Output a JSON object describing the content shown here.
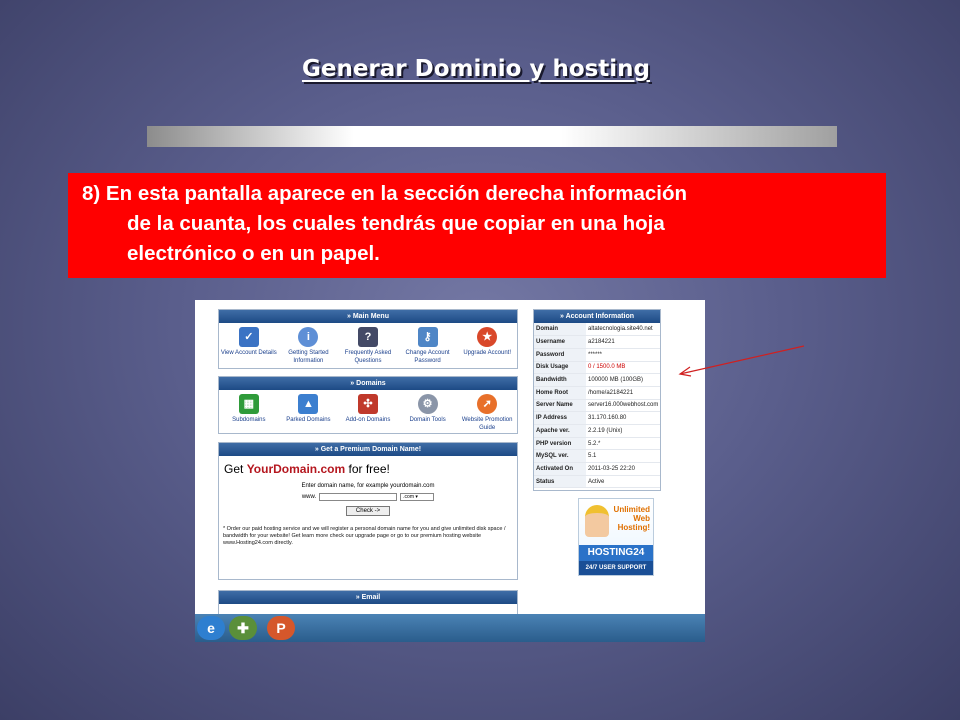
{
  "slide": {
    "title": "Generar Dominio y hosting",
    "step_line1_left": "8) En esta pantalla aparece en la sección derecha información",
    "step_line2": "de la cuanta, los cuales tendrás que copiar en una hoja",
    "step_line3": "electrónico o en un papel."
  },
  "main_menu": {
    "title": "» Main Menu",
    "items": [
      {
        "label": "View Account Details",
        "icon": "checklist-icon"
      },
      {
        "label": "Getting Started Information",
        "icon": "info-icon"
      },
      {
        "label": "Frequently Asked Questions",
        "icon": "question-icon"
      },
      {
        "label": "Change Account Password",
        "icon": "key-icon"
      },
      {
        "label": "Upgrade Account!",
        "icon": "award-icon"
      }
    ]
  },
  "domains": {
    "title": "» Domains",
    "items": [
      {
        "label": "Subdomains",
        "icon": "cubes-icon"
      },
      {
        "label": "Parked Domains",
        "icon": "parked-icon"
      },
      {
        "label": "Add-on Domains",
        "icon": "addon-icon"
      },
      {
        "label": "Domain Tools",
        "icon": "gears-icon"
      },
      {
        "label": "Website Promotion Guide",
        "icon": "promotion-icon"
      }
    ]
  },
  "premium": {
    "title": "» Get a Premium Domain Name!",
    "get": "Get ",
    "domain": "YourDomain.com",
    "free": " for free!",
    "enter_text": "Enter domain name, for example yourdomain.com",
    "www": "www.",
    "tld": ".com",
    "check_label": "Check ->",
    "note": "* Order our paid hosting service and we will register a personal domain name for you and give unlimited disk space / bandwidth for your website! Get learn more check our upgrade page or go to our premium hosting website www.Hosting24.com directly."
  },
  "email": {
    "title": "» Email"
  },
  "account": {
    "title": "» Account Information",
    "rows": [
      {
        "k": "Domain",
        "v": "altatecnologia.site40.net"
      },
      {
        "k": "Username",
        "v": "a2184221"
      },
      {
        "k": "Password",
        "v": "******"
      },
      {
        "k": "Disk Usage",
        "v": "0 / 1500.0 MB"
      },
      {
        "k": "Bandwidth",
        "v": "100000 MB (100GB)"
      },
      {
        "k": "Home Root",
        "v": "/home/a2184221"
      },
      {
        "k": "Server Name",
        "v": "server16.000webhost.com"
      },
      {
        "k": "IP Address",
        "v": "31.170.160.80"
      },
      {
        "k": "Apache ver.",
        "v": "2.2.19 (Unix)"
      },
      {
        "k": "PHP version",
        "v": "5.2.*"
      },
      {
        "k": "MySQL ver.",
        "v": "5.1"
      },
      {
        "k": "Activated On",
        "v": "2011-03-25 22:20"
      },
      {
        "k": "Status",
        "v": "Active"
      }
    ]
  },
  "promo": {
    "line1": "Unlimited",
    "line2": "Web",
    "line3": "Hosting!",
    "brand": "HOSTING24",
    "support": "24/7 USER SUPPORT"
  },
  "taskbar": {
    "icons": [
      "internet-explorer-icon",
      "programs-icon",
      "powerpoint-icon"
    ]
  },
  "colors": {
    "red_box": "#ff0000",
    "panel_header": "#2b5a96",
    "accent_red": "#c00000"
  }
}
